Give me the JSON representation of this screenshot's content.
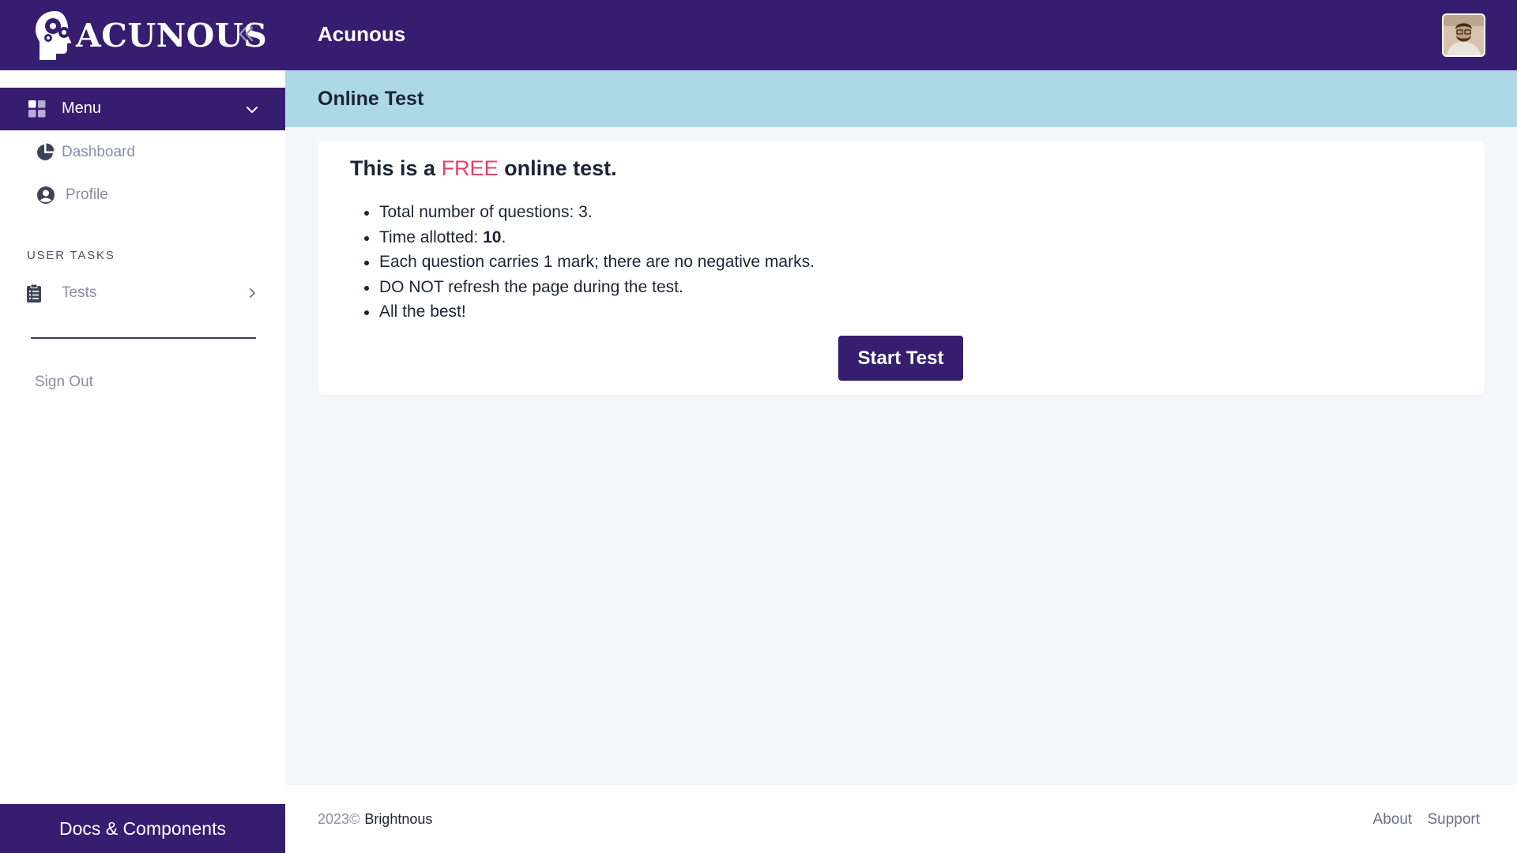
{
  "topbar": {
    "brand_name": "ACUNOUS",
    "app_title": "Acunous",
    "colors": {
      "primary": "#371d70",
      "white": "#ffffff"
    }
  },
  "sidebar": {
    "menu_label": "Menu",
    "items": [
      {
        "label": "Dashboard",
        "icon": "pie-chart-icon"
      },
      {
        "label": "Profile",
        "icon": "user-circle-icon"
      }
    ],
    "section_title": "USER TASKS",
    "tasks": [
      {
        "label": "Tests",
        "icon": "clipboard-icon"
      }
    ],
    "signout_label": "Sign Out",
    "docs_button": "Docs & Components"
  },
  "page": {
    "title": "Online Test",
    "header_color": "#add8e6"
  },
  "card": {
    "heading_pre": "This is a",
    "heading_free": "FREE",
    "heading_post": "online test.",
    "accent": "#e83e6c",
    "rules": {
      "questions": "Total number of questions: 3.",
      "time_label": "Time allotted: ",
      "time_value": "10",
      "time_suffix": ".",
      "marks": "Each question carries 1 mark; there are no negative marks.",
      "refresh": "DO NOT refresh the page during the test.",
      "best": "All the best!"
    },
    "start_button": "Start Test"
  },
  "footer": {
    "year": "2023©",
    "owner": "Brightnous",
    "links": [
      "About",
      "Support"
    ]
  }
}
